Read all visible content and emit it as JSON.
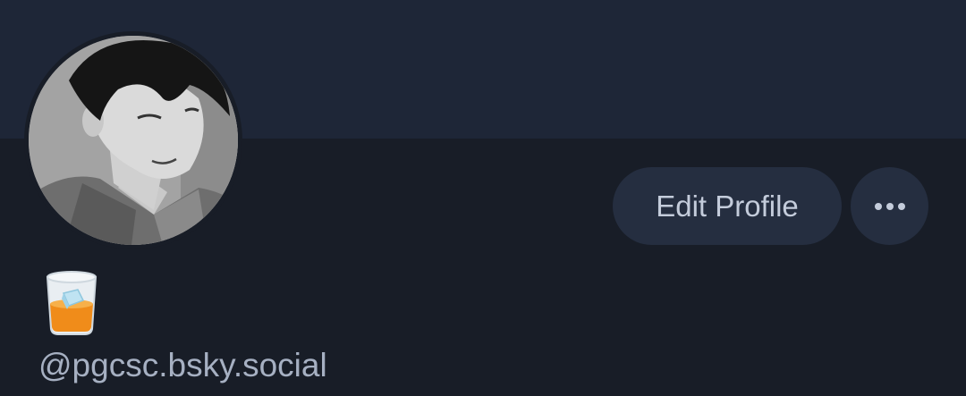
{
  "profile": {
    "display_name": "🥃",
    "handle": "@pgcsc.bsky.social",
    "avatar_icon": "avatar-image",
    "actions": {
      "edit_label": "Edit Profile",
      "more_icon": "ellipsis-icon"
    }
  },
  "colors": {
    "background": "#181d27",
    "banner": "#1e2637",
    "button_bg": "#252e40",
    "button_text": "#c4ccdb",
    "handle_text": "#a6b0c2"
  }
}
